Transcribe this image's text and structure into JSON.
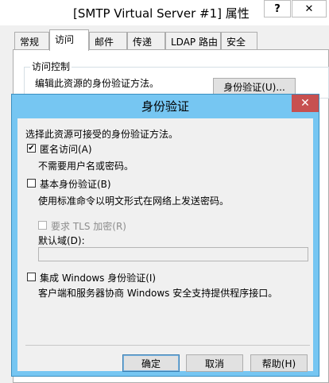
{
  "background_window": {
    "title": "[SMTP Virtual Server #1] 属性",
    "help_glyph": "?",
    "close_glyph": "✕",
    "tabs": [
      {
        "label": "常规"
      },
      {
        "label": "访问"
      },
      {
        "label": "邮件"
      },
      {
        "label": "传递"
      },
      {
        "label": "LDAP 路由"
      },
      {
        "label": "安全"
      }
    ],
    "active_tab": "访问",
    "access_control": {
      "title": "访问控制",
      "description": "编辑此资源的身份验证方法。",
      "auth_button": "身份验证(U)..."
    }
  },
  "dialog": {
    "title": "身份验证",
    "close_glyph": "✕",
    "intro": "选择此资源可接受的身份验证方法。",
    "anonymous": {
      "label": "匿名访问(A)",
      "checked": true,
      "description": "不需要用户名或密码。"
    },
    "basic": {
      "label": "基本身份验证(B)",
      "checked": false,
      "description": "使用标准命令以明文形式在网络上发送密码。"
    },
    "tls": {
      "label": "要求 TLS 加密(R)",
      "checked": false,
      "enabled": false
    },
    "default_domain": {
      "label": "默认域(D):",
      "value": ""
    },
    "windows": {
      "label": "集成 Windows 身份验证(I)",
      "checked": false,
      "description": "客户端和服务器协商 Windows 安全支持提供程序接口。"
    },
    "buttons": {
      "ok": "确定",
      "cancel": "取消",
      "help": "帮助(H)"
    }
  },
  "colors": {
    "dialog_frame": "#76c6f2",
    "close_button": "#c75050",
    "window_bg": "#f0f0f0"
  }
}
